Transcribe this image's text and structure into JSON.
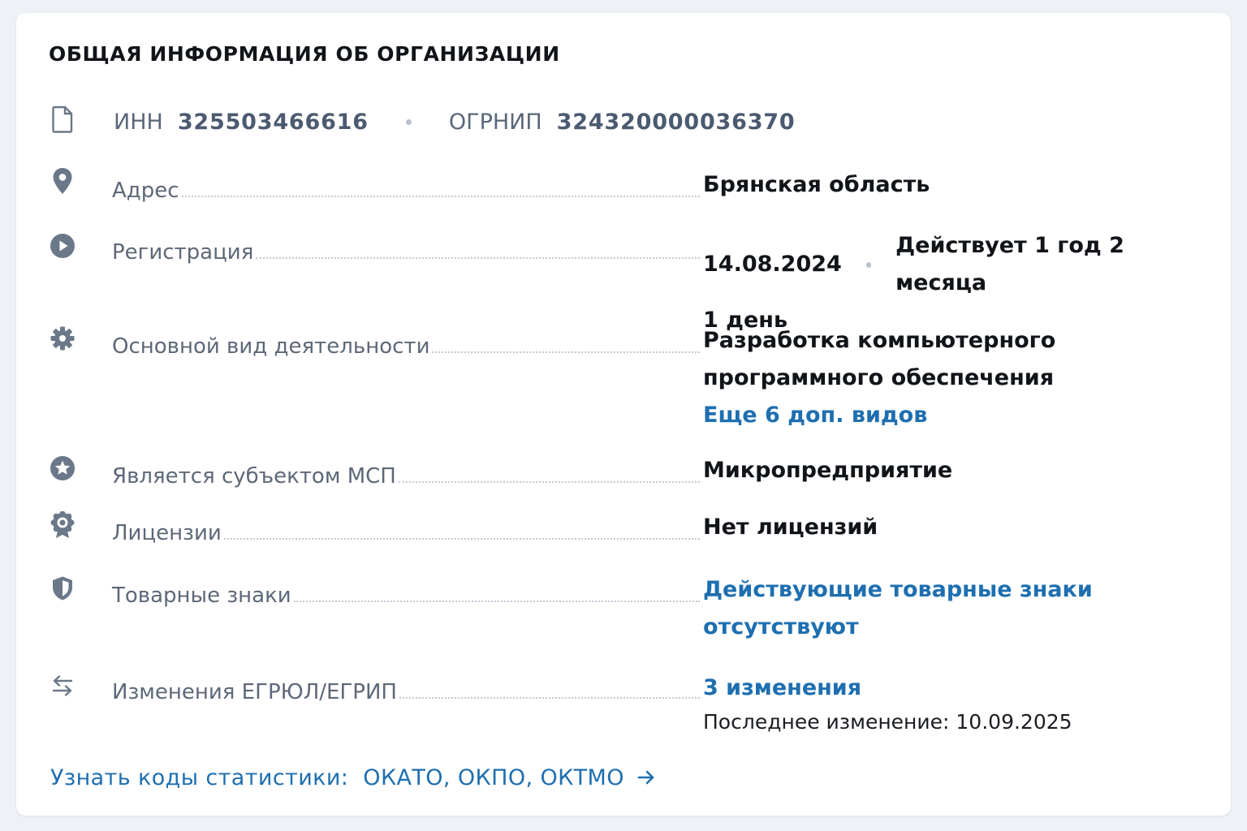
{
  "section": {
    "title": "ОБЩАЯ ИНФОРМАЦИЯ ОБ ОРГАНИЗАЦИИ"
  },
  "ids": {
    "icon": "document-icon",
    "inn_label": "ИНН",
    "inn_value": "325503466616",
    "ogrnip_label": "ОГРНИП",
    "ogrnip_value": "324320000036370"
  },
  "rows": {
    "address": {
      "icon": "location-pin-icon",
      "label": "Адрес",
      "value": "Брянская область"
    },
    "registration": {
      "icon": "play-circle-icon",
      "label": "Регистрация",
      "date": "14.08.2024",
      "duration_line1": "Действует 1 год 2 месяца",
      "duration_line2": "1 день"
    },
    "activity": {
      "icon": "gear-icon",
      "label": "Основной вид деятельности",
      "value_line1": "Разработка компьютерного",
      "value_line2": "программного обеспечения",
      "more_link": "Еще 6 доп. видов"
    },
    "msp": {
      "icon": "star-circle-icon",
      "label": "Является субъектом МСП",
      "value": "Микропредприятие"
    },
    "licenses": {
      "icon": "badge-icon",
      "label": "Лицензии",
      "value": "Нет лицензий"
    },
    "trademarks": {
      "icon": "shield-icon",
      "label": "Товарные знаки",
      "value_line1": "Действующие товарные знаки",
      "value_line2": "отсутствуют"
    },
    "changes": {
      "icon": "swap-arrows-icon",
      "label": "Изменения ЕГРЮЛ/ЕГРИП",
      "link": "3 изменения",
      "last_change_label": "Последнее изменение:",
      "last_change_date": "10.09.2025"
    }
  },
  "footer_link": {
    "text": "Узнать коды статистики:",
    "codes": "ОКАТО, ОКПО, ОКТМО",
    "icon": "arrow-right-icon"
  },
  "colors": {
    "link": "#1e6fb0",
    "icon": "#6b7889",
    "label": "#5d6878",
    "value": "#111418"
  }
}
